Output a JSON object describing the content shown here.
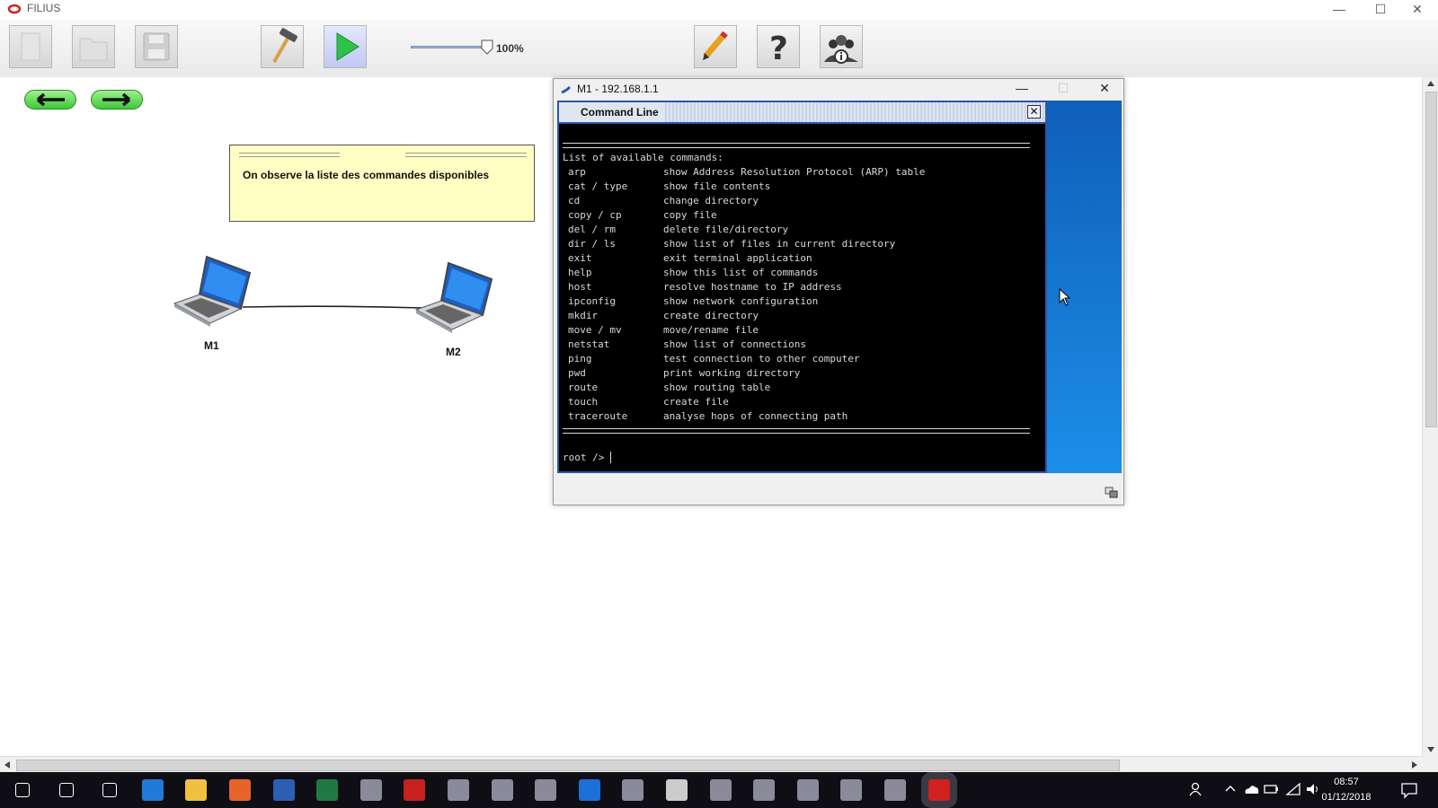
{
  "app": {
    "title": "FILIUS",
    "window_controls": {
      "minimize": "—",
      "maximize": "☐",
      "close": "✕"
    }
  },
  "toolbar": {
    "zoom_label": "100%",
    "zoom_fraction": 1.0,
    "icons": [
      "new-file-icon",
      "open-folder-icon",
      "save-icon",
      "hammer-icon",
      "play-icon",
      "pencil-icon",
      "help-icon",
      "about-icon"
    ]
  },
  "nav": {
    "back": "back-arrow-icon",
    "forward": "forward-arrow-icon"
  },
  "note": {
    "text": "On observe la liste des commandes disponibles"
  },
  "nodes": [
    {
      "label": "M1"
    },
    {
      "label": "M2"
    }
  ],
  "terminal": {
    "window_title": "M1 - 192.168.1.1",
    "panel_title": "Command Line",
    "heading": "List of available commands:",
    "commands": [
      {
        "cmd": "arp",
        "desc": "show Address Resolution Protocol (ARP) table"
      },
      {
        "cmd": "cat / type",
        "desc": "show file contents"
      },
      {
        "cmd": "cd",
        "desc": "change directory"
      },
      {
        "cmd": "copy / cp",
        "desc": "copy file"
      },
      {
        "cmd": "del / rm",
        "desc": "delete file/directory"
      },
      {
        "cmd": "dir / ls",
        "desc": "show list of files in current directory"
      },
      {
        "cmd": "exit",
        "desc": "exit terminal application"
      },
      {
        "cmd": "help",
        "desc": "show this list of commands"
      },
      {
        "cmd": "host",
        "desc": "resolve hostname to IP address"
      },
      {
        "cmd": "ipconfig",
        "desc": "show network configuration"
      },
      {
        "cmd": "mkdir",
        "desc": "create directory"
      },
      {
        "cmd": "move / mv",
        "desc": "move/rename file"
      },
      {
        "cmd": "netstat",
        "desc": "show list of connections"
      },
      {
        "cmd": "ping",
        "desc": "test connection to other computer"
      },
      {
        "cmd": "pwd",
        "desc": "print working directory"
      },
      {
        "cmd": "route",
        "desc": "show routing table"
      },
      {
        "cmd": "touch",
        "desc": "create file"
      },
      {
        "cmd": "traceroute",
        "desc": "analyse hops of connecting path"
      }
    ],
    "prompt": "root />"
  },
  "taskbar": {
    "apps": [
      "start-icon",
      "search-icon",
      "task-view-icon",
      "edge-icon",
      "explorer-icon",
      "firefox-icon",
      "word-icon",
      "excel-icon",
      "app-icon",
      "filezilla-icon",
      "app-icon",
      "app-icon",
      "app-icon",
      "teamviewer-icon",
      "app-icon",
      "calculator-icon",
      "app-icon",
      "app-icon",
      "app-icon",
      "app-icon",
      "app-icon",
      "filius-icon"
    ],
    "time": "08:57",
    "date": "01/12/2018"
  }
}
